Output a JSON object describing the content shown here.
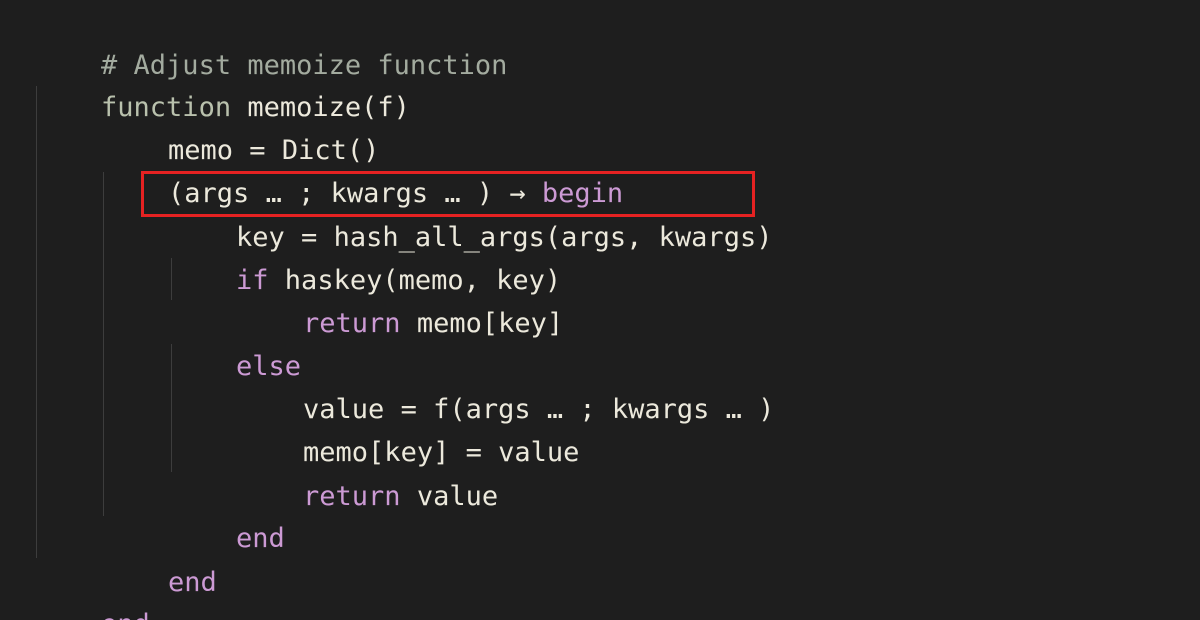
{
  "code": {
    "comment": "# Adjust memoize function",
    "line2_kw": "function",
    "line2_rest": " memoize(f)",
    "line3": "memo = Dict()",
    "line4_args": "(args … ; kwargs … ) → ",
    "line4_kw": "begin",
    "line5": "key = hash_all_args(args, kwargs)",
    "line6_kw": "if",
    "line6_rest": " haskey(memo, key)",
    "line7_kw": "return",
    "line7_rest": " memo[key]",
    "line8_kw": "else",
    "line9": "value = f(args … ; kwargs … )",
    "line10": "memo[key] = value",
    "line11_kw": "return",
    "line11_rest": " value",
    "line12_kw": "end",
    "line13_kw": "end",
    "line14_kw": "end"
  },
  "colors": {
    "background": "#1e1e1e",
    "keyword": "#cc9ad4",
    "comment": "#a3ab9f",
    "text": "#ece9dc",
    "highlight": "#e52222"
  }
}
